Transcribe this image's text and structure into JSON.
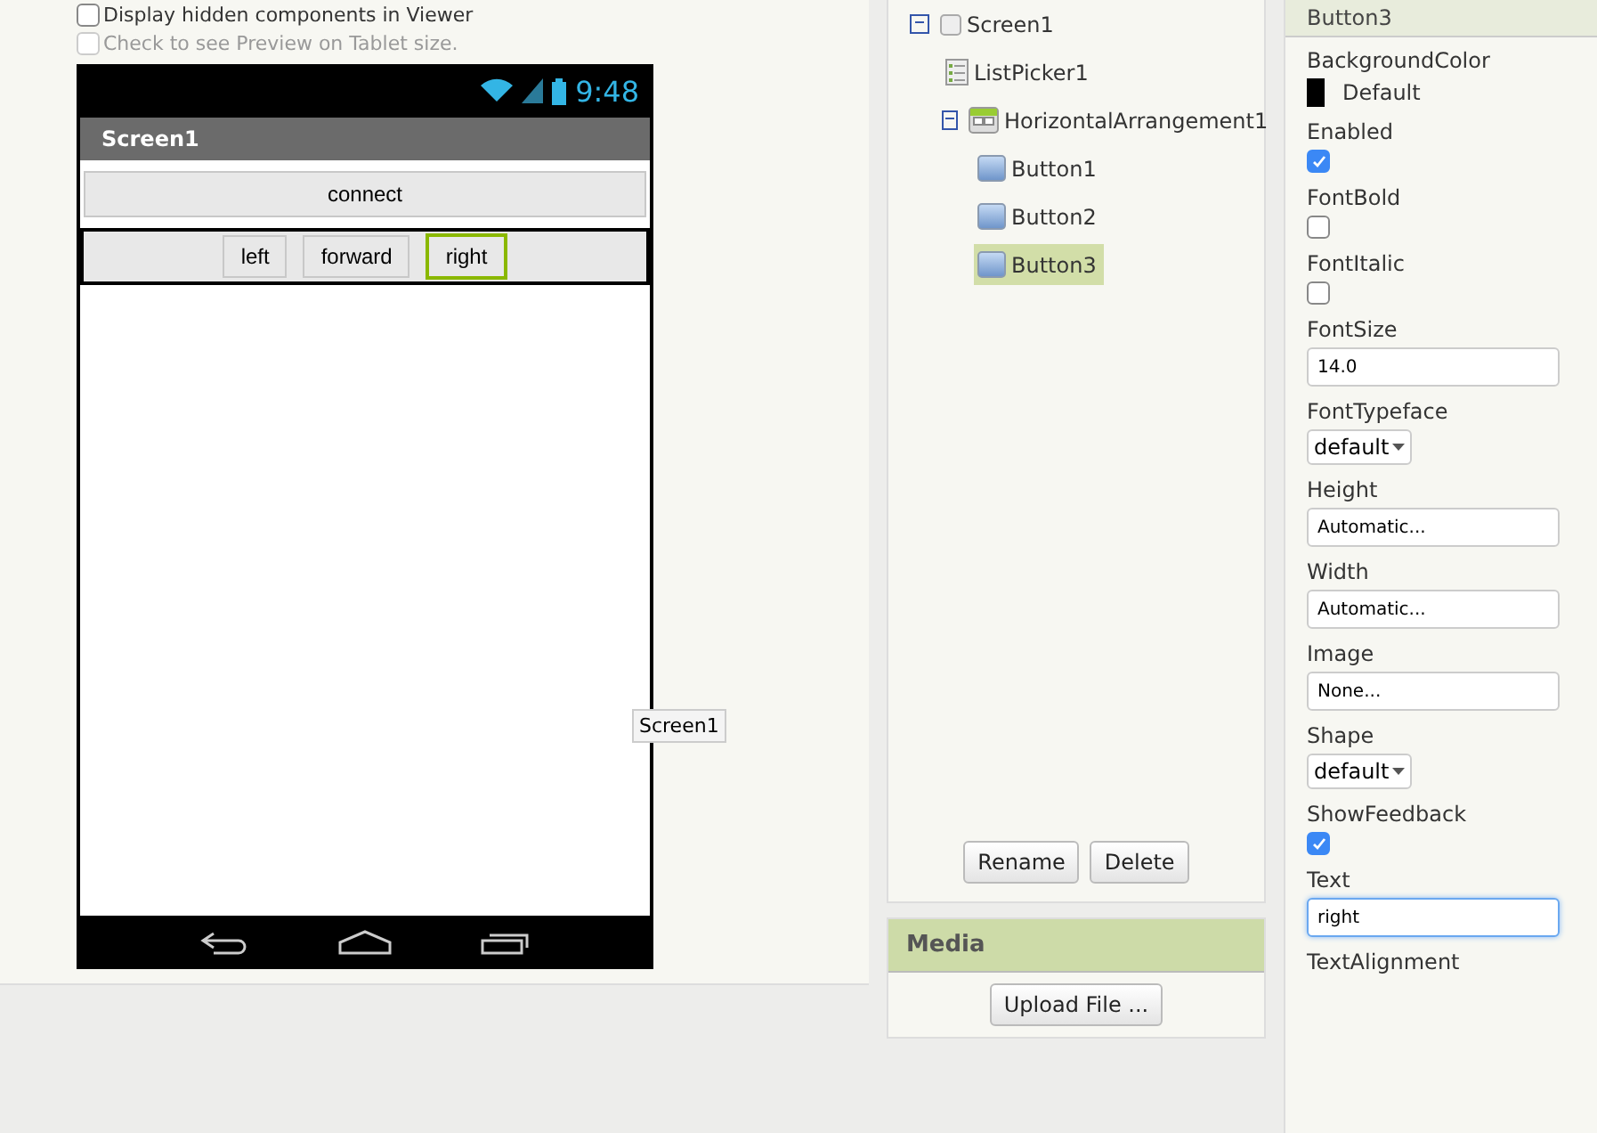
{
  "viewer": {
    "options": [
      {
        "label": "Display hidden components in Viewer",
        "checked": false,
        "disabled": false
      },
      {
        "label": "Check to see Preview on Tablet size.",
        "checked": false,
        "disabled": true
      }
    ],
    "phone": {
      "time": "9:48",
      "title": "Screen1",
      "components": [
        {
          "kind": "button",
          "text": "connect",
          "selected": false
        },
        {
          "kind": "arrangement",
          "children": [
            {
              "text": "left",
              "selected": false
            },
            {
              "text": "forward",
              "selected": false
            },
            {
              "text": "right",
              "selected": true
            }
          ]
        }
      ]
    },
    "tooltip": "Screen1"
  },
  "components": {
    "tree": [
      {
        "label": "Screen1",
        "kind": "screen",
        "expanded": true,
        "selected": false,
        "children": [
          {
            "label": "ListPicker1",
            "kind": "listpicker",
            "selected": false
          },
          {
            "label": "HorizontalArrangement1",
            "kind": "arrangement",
            "expanded": true,
            "selected": false,
            "children": [
              {
                "label": "Button1",
                "kind": "button",
                "selected": false
              },
              {
                "label": "Button2",
                "kind": "button",
                "selected": false
              },
              {
                "label": "Button3",
                "kind": "button",
                "selected": true
              }
            ]
          }
        ]
      }
    ],
    "buttons": [
      "Rename",
      "Delete"
    ]
  },
  "media": {
    "title": "Media",
    "button": "Upload File ..."
  },
  "properties": {
    "title": "Button3",
    "items": [
      {
        "kind": "color",
        "label": "BackgroundColor",
        "value": "Default",
        "color": "#000000"
      },
      {
        "kind": "checkbox",
        "label": "Enabled",
        "checked": true
      },
      {
        "kind": "checkbox",
        "label": "FontBold",
        "checked": false
      },
      {
        "kind": "checkbox",
        "label": "FontItalic",
        "checked": false
      },
      {
        "kind": "text",
        "label": "FontSize",
        "value": "14.0",
        "focused": false
      },
      {
        "kind": "dropdown",
        "label": "FontTypeface",
        "value": "default"
      },
      {
        "kind": "text",
        "label": "Height",
        "value": "Automatic...",
        "focused": false
      },
      {
        "kind": "text",
        "label": "Width",
        "value": "Automatic...",
        "focused": false
      },
      {
        "kind": "text",
        "label": "Image",
        "value": "None...",
        "focused": false
      },
      {
        "kind": "dropdown",
        "label": "Shape",
        "value": "default"
      },
      {
        "kind": "checkbox",
        "label": "ShowFeedback",
        "checked": true
      },
      {
        "kind": "text",
        "label": "Text",
        "value": "right",
        "focused": true
      },
      {
        "kind": "label",
        "label": "TextAlignment"
      }
    ]
  }
}
